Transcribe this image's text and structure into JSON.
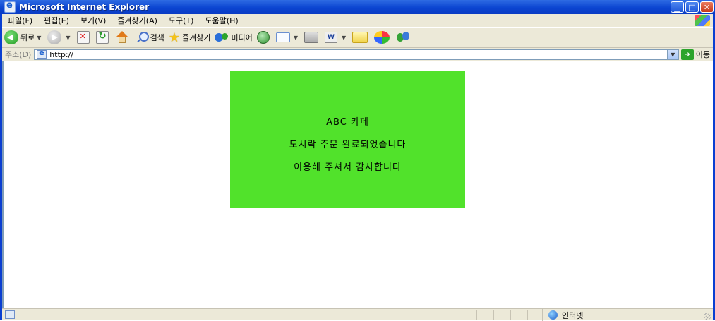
{
  "window": {
    "title": "Microsoft Internet Explorer"
  },
  "menubar": {
    "items": [
      "파일(F)",
      "편집(E)",
      "보기(V)",
      "즐겨찾기(A)",
      "도구(T)",
      "도움말(H)"
    ]
  },
  "toolbar": {
    "back_label": "뒤로",
    "search_label": "검색",
    "favorites_label": "즐겨찾기",
    "media_label": "미디어"
  },
  "addressbar": {
    "label": "주소(D)",
    "value": "http://",
    "go_label": "이동"
  },
  "content": {
    "lines": [
      "ABC 카페",
      "도시락 주문 완료되었습니다",
      "이용해 주셔서 감사합니다"
    ],
    "box_color": "#51e22b"
  },
  "statusbar": {
    "zone_label": "인터넷"
  }
}
